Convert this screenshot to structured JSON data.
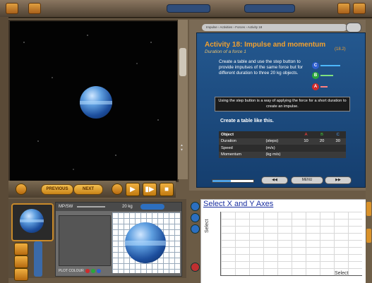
{
  "simulation": {
    "controls": {
      "previous_label": "PREVIOUS",
      "next_label": "NEXT"
    },
    "mass_panel": {
      "header_label": "MP/SW",
      "mass_value": "20 kg",
      "plot_label": "PLOT COLOUR"
    }
  },
  "activity": {
    "breadcrumb": "Impulse › Activities › Forces › Activity 18",
    "title": "Activity 18: Impulse and momentum",
    "number": "(18.2)",
    "subtitle": "Duration of a force 1",
    "instructions": "Create a table and use the step button to provide impulses of the same force but for different duration to three 20 kg objects.",
    "note": "Using the step button is a way of applying the force for a short duration to create an impulse.",
    "table_heading": "Create a table like this.",
    "legend": [
      "C",
      "B",
      "A"
    ],
    "table": {
      "header": [
        "Object",
        "A",
        "B",
        "C"
      ],
      "rows": [
        [
          "Duration",
          "(steps)",
          "10",
          "20",
          "30"
        ],
        [
          "Speed",
          "(m/s)",
          "",
          "",
          ""
        ],
        [
          "Momentum",
          "(kg m/s)",
          "",
          "",
          ""
        ]
      ]
    },
    "nav": {
      "menu_label": "MENU"
    },
    "progress": 0.45
  },
  "graph": {
    "title": "Select X and Y Axes",
    "y_label": "Select",
    "x_label": "Select"
  },
  "colors": {
    "panel_blue": "#1f4f86",
    "title_orange": "#f0a030",
    "link_blue": "#1a2fa0",
    "legend_c": "#2f5fd0",
    "legend_b": "#2aa83a",
    "legend_a": "#d02a2a"
  }
}
